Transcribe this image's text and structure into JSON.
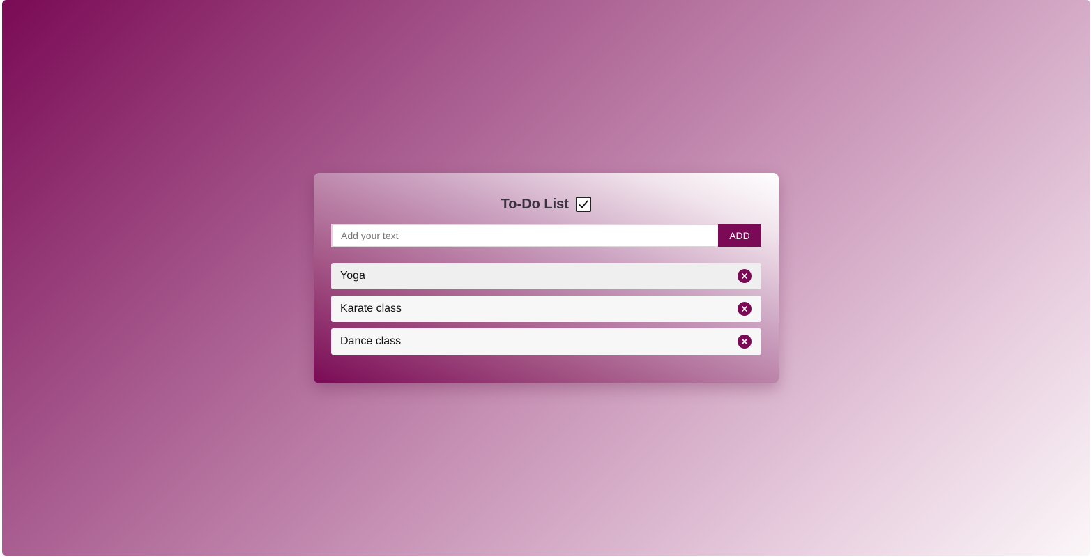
{
  "app": {
    "title": "To-Do List",
    "title_icon": "checkbox-checked-icon"
  },
  "input": {
    "value": "",
    "placeholder": "Add your text"
  },
  "add_button": {
    "label": "ADD"
  },
  "tasks": [
    {
      "label": "Yoga",
      "remove_icon": "close-circle-icon"
    },
    {
      "label": "Karate class",
      "remove_icon": "close-circle-icon"
    },
    {
      "label": "Dance class",
      "remove_icon": "close-circle-icon"
    }
  ],
  "colors": {
    "accent": "#7a0a55",
    "background_start": "#7a0a55",
    "background_end": "#fbf6f8",
    "task_bg": "#f8f7f8"
  }
}
